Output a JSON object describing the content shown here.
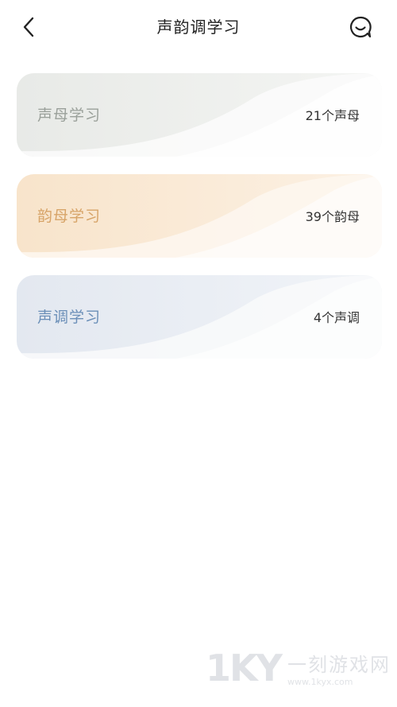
{
  "header": {
    "title": "声韵调学习",
    "back_icon": "chevron-left-icon",
    "right_icon": "chat-bubble-icon"
  },
  "cards": [
    {
      "label": "声母学习",
      "count": "21个声母",
      "color": "#e9ebe8"
    },
    {
      "label": "韵母学习",
      "count": "39个韵母",
      "color": "#f8e7d1"
    },
    {
      "label": "声调学习",
      "count": "4个声调",
      "color": "#e4e9f1"
    }
  ],
  "watermark": {
    "logo": "1KY",
    "name": "一刻游戏网",
    "url": "www.1kyx.com"
  }
}
